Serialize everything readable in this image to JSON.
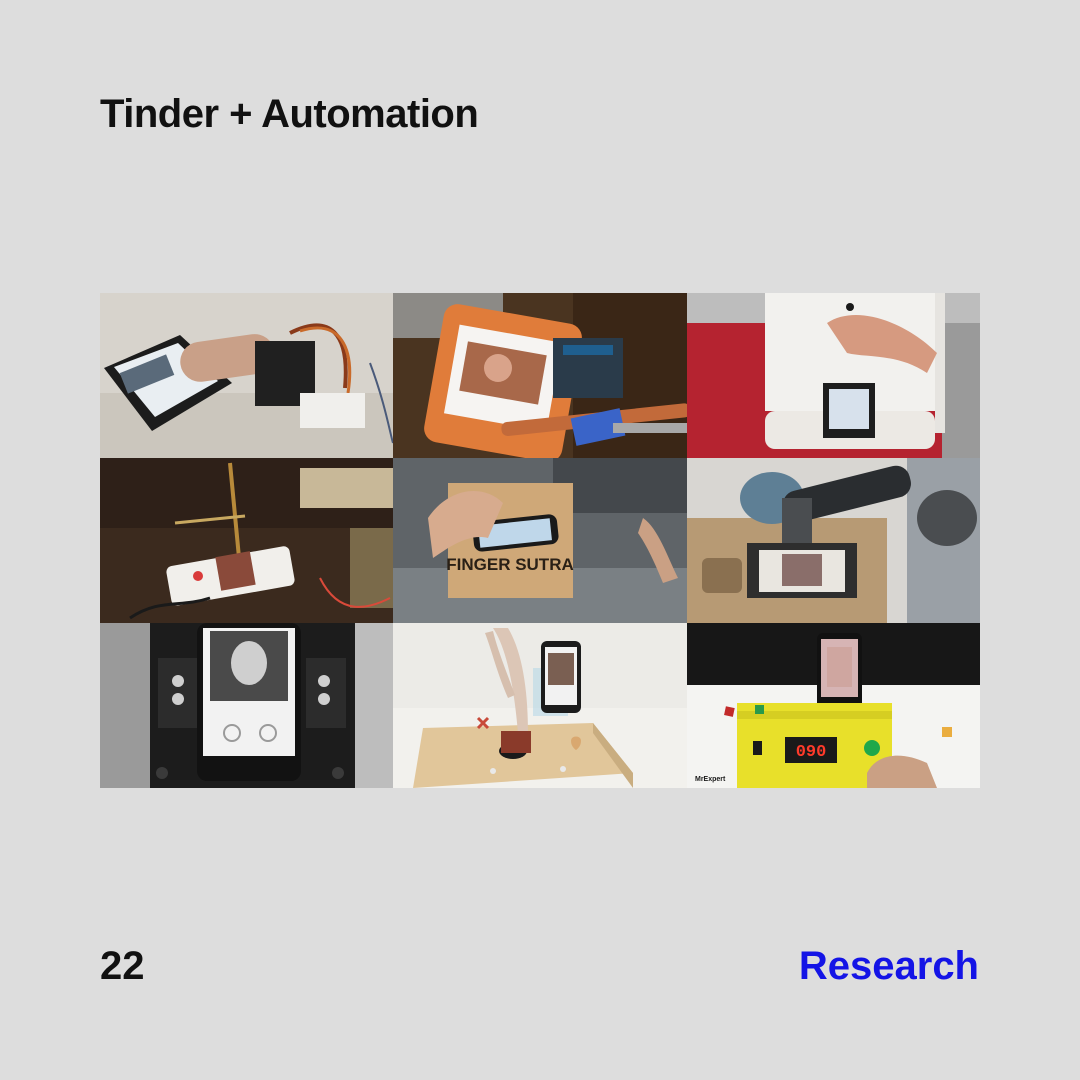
{
  "header": {
    "title": "Tinder + Automation"
  },
  "footer": {
    "page_number": "22",
    "section": "Research"
  },
  "colors": {
    "accent": "#1414e6",
    "background": "#dddddd",
    "text": "#111111"
  },
  "photos": [
    {
      "name": "silicone-finger-servo-photo"
    },
    {
      "name": "stylus-arduino-swiper-photo"
    },
    {
      "name": "white-stand-finger-photo"
    },
    {
      "name": "pen-plotter-swiper-photo"
    },
    {
      "name": "finger-sutra-box-photo",
      "caption": "FINGER SUTRA"
    },
    {
      "name": "robot-arm-swiper-photo"
    },
    {
      "name": "grayscale-phone-rig-photo"
    },
    {
      "name": "mannequin-hand-swiper-photo"
    },
    {
      "name": "yellow-box-counter-photo",
      "counter": "090",
      "watermark": "MrExpert"
    }
  ]
}
